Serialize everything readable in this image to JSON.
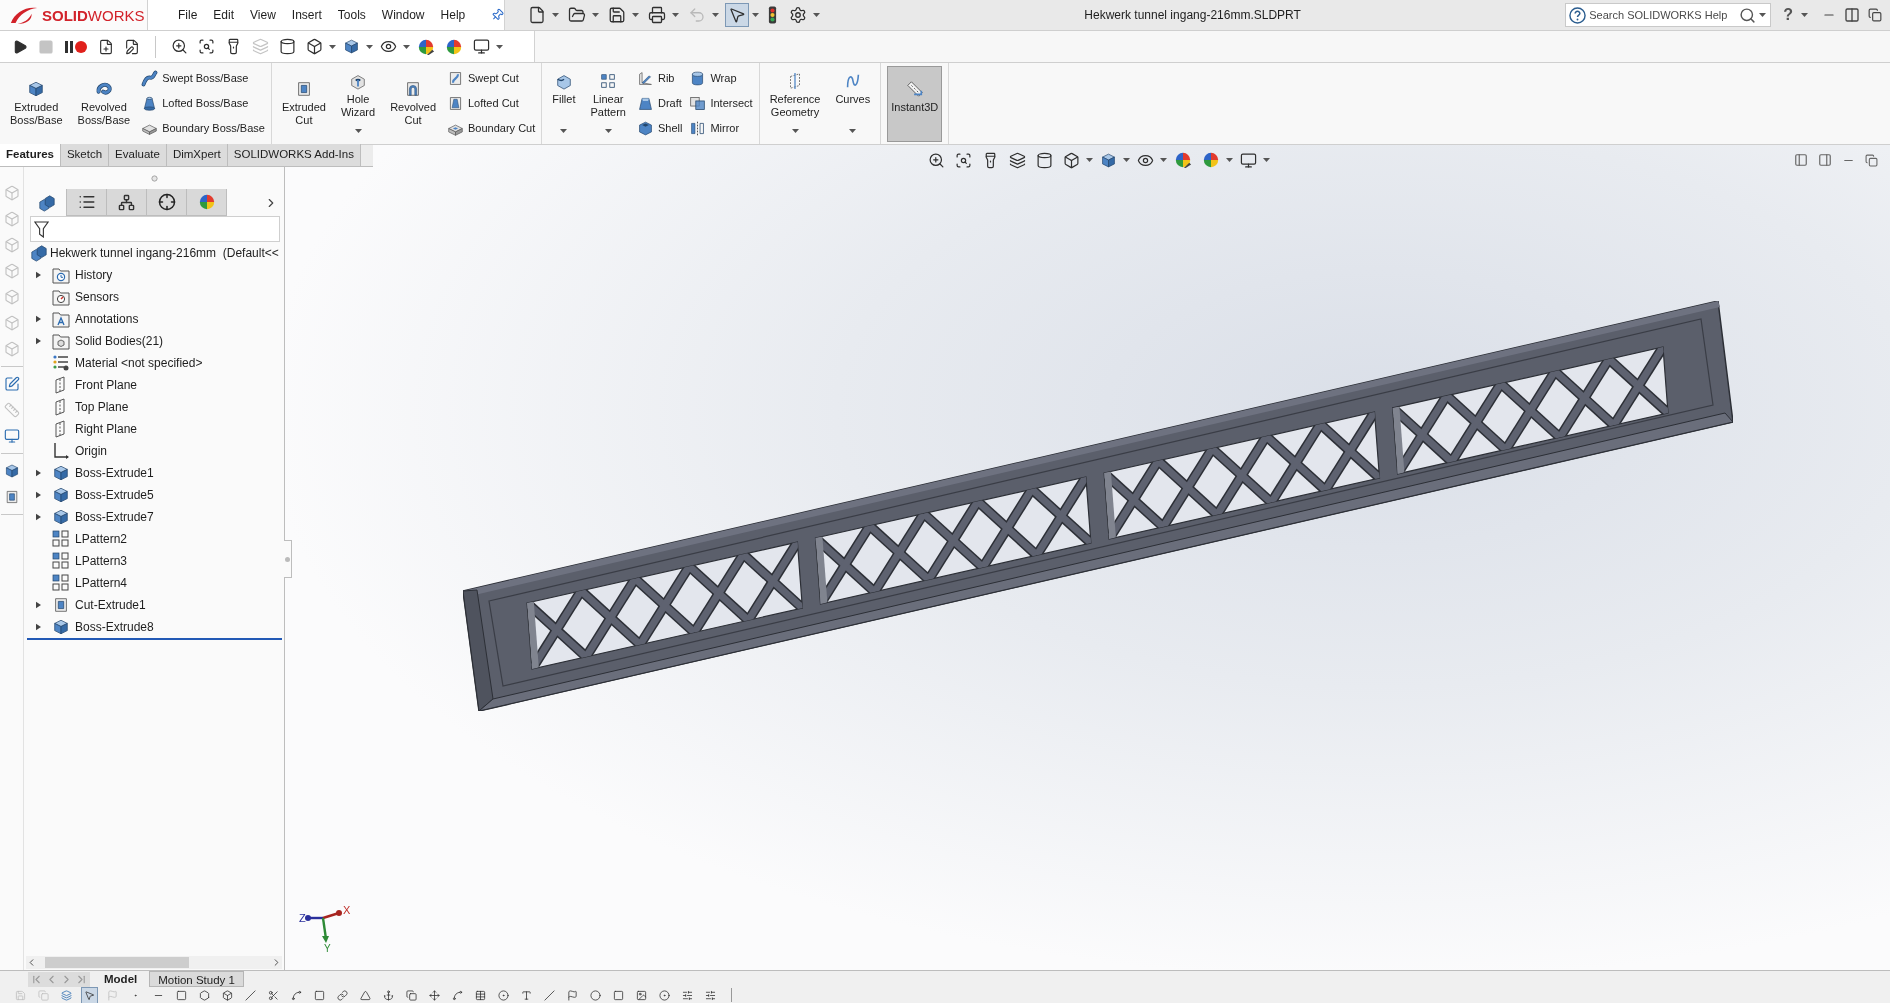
{
  "logo": {
    "text": "**SOLID**WORKS"
  },
  "menu": [
    {
      "label": "File"
    },
    {
      "label": "Edit"
    },
    {
      "label": "View"
    },
    {
      "label": "Insert"
    },
    {
      "label": "Tools"
    },
    {
      "label": "Window"
    },
    {
      "label": "Help"
    }
  ],
  "quick_access": [
    {
      "kind": "new",
      "dropdown": true,
      "disabled": false,
      "active": false
    },
    {
      "kind": "open",
      "dropdown": true,
      "disabled": false,
      "active": false
    },
    {
      "kind": "save",
      "dropdown": true,
      "disabled": false,
      "active": false
    },
    {
      "kind": "print",
      "dropdown": true,
      "disabled": false,
      "active": false
    },
    {
      "kind": "undo",
      "dropdown": true,
      "disabled": true,
      "active": false
    },
    {
      "kind": "select",
      "dropdown": true,
      "disabled": false,
      "active": true
    },
    {
      "kind": "rebuild",
      "dropdown": false,
      "disabled": false,
      "active": false
    },
    {
      "kind": "options",
      "dropdown": true,
      "disabled": false,
      "active": false
    }
  ],
  "window": {
    "title": "Hekwerk tunnel ingang-216mm.SLDPRT"
  },
  "search": {
    "placeholder": "Search SOLIDWORKS Help"
  },
  "help": {
    "label": "?"
  },
  "macro_toolbar": [
    {
      "kind": "play",
      "dropdown": false,
      "disabled": false
    },
    {
      "kind": "stop",
      "dropdown": false,
      "disabled": true
    },
    {
      "kind": "pause-record",
      "dropdown": false,
      "disabled": false
    },
    {
      "kind": "new-macro",
      "dropdown": false,
      "disabled": false
    },
    {
      "kind": "edit-macro",
      "dropdown": false,
      "disabled": false
    }
  ],
  "view_toolbar": [
    {
      "kind": "zoom-fit",
      "dropdown": false,
      "disabled": false
    },
    {
      "kind": "zoom-area",
      "dropdown": false,
      "disabled": false
    },
    {
      "kind": "previous-view",
      "dropdown": false,
      "disabled": false
    },
    {
      "kind": "section-view",
      "dropdown": false,
      "disabled": true
    },
    {
      "kind": "dynamic-view",
      "dropdown": false,
      "disabled": false
    },
    {
      "kind": "view-orientation",
      "dropdown": true,
      "disabled": false
    },
    {
      "kind": "display-style",
      "dropdown": true,
      "disabled": false
    },
    {
      "kind": "hide-show",
      "dropdown": true,
      "disabled": false
    },
    {
      "kind": "edit-appearance",
      "dropdown": false,
      "disabled": false
    },
    {
      "kind": "apply-scene",
      "dropdown": false,
      "disabled": false
    },
    {
      "kind": "view-settings",
      "dropdown": true,
      "disabled": false
    }
  ],
  "command_manager": {
    "groups": [
      {
        "buttons": [
          {
            "kind": "large",
            "label": "Extruded Boss/Base",
            "dropdown": false,
            "active": false
          },
          {
            "kind": "large",
            "label": "Revolved Boss/Base",
            "dropdown": false,
            "active": false
          },
          {
            "kind": "stack",
            "items": [
              {
                "label": "Swept Boss/Base"
              },
              {
                "label": "Lofted Boss/Base"
              },
              {
                "label": "Boundary Boss/Base"
              }
            ]
          }
        ]
      },
      {
        "buttons": [
          {
            "kind": "large",
            "label": "Extruded Cut",
            "dropdown": false,
            "active": false
          },
          {
            "kind": "large",
            "label": "Hole Wizard",
            "dropdown": true,
            "active": false
          },
          {
            "kind": "large",
            "label": "Revolved Cut",
            "dropdown": false,
            "active": false
          },
          {
            "kind": "stack",
            "items": [
              {
                "label": "Swept Cut"
              },
              {
                "label": "Lofted Cut"
              },
              {
                "label": "Boundary Cut"
              }
            ]
          }
        ]
      },
      {
        "buttons": [
          {
            "kind": "large",
            "label": "Fillet",
            "dropdown": true,
            "active": false
          },
          {
            "kind": "large",
            "label": "Linear Pattern",
            "dropdown": true,
            "active": false
          },
          {
            "kind": "stack",
            "items": [
              {
                "label": "Rib"
              },
              {
                "label": "Draft"
              },
              {
                "label": "Shell"
              }
            ]
          },
          {
            "kind": "stack",
            "items": [
              {
                "label": "Wrap"
              },
              {
                "label": "Intersect"
              },
              {
                "label": "Mirror"
              }
            ]
          }
        ]
      },
      {
        "buttons": [
          {
            "kind": "large",
            "label": "Reference Geometry",
            "dropdown": true,
            "active": false
          },
          {
            "kind": "large",
            "label": "Curves",
            "dropdown": true,
            "active": false
          }
        ]
      },
      {
        "buttons": [
          {
            "kind": "large",
            "label": "Instant3D",
            "dropdown": false,
            "active": true
          }
        ]
      }
    ]
  },
  "command_tabs": [
    {
      "label": "Features",
      "selected": true
    },
    {
      "label": "Sketch",
      "selected": false
    },
    {
      "label": "Evaluate",
      "selected": false
    },
    {
      "label": "DimXpert",
      "selected": false
    },
    {
      "label": "SOLIDWORKS Add-Ins",
      "selected": false
    }
  ],
  "side_toolbar": [
    [
      {
        "kind": "view-cube",
        "disabled": true
      },
      {
        "kind": "view-cube",
        "disabled": true
      },
      {
        "kind": "view-cube",
        "disabled": true
      },
      {
        "kind": "view-cube",
        "disabled": true
      },
      {
        "kind": "view-cube",
        "disabled": true
      },
      {
        "kind": "view-cube",
        "disabled": true
      },
      {
        "kind": "view-cube",
        "disabled": true
      }
    ],
    [
      {
        "kind": "sketch",
        "disabled": false
      },
      {
        "kind": "smart-dimension",
        "disabled": true
      },
      {
        "kind": "display-sketch",
        "disabled": false
      }
    ],
    [
      {
        "kind": "extrude",
        "disabled": false
      },
      {
        "kind": "cut",
        "disabled": false
      }
    ]
  ],
  "feature_manager": {
    "tabs": [
      {
        "kind": "features",
        "selected": true
      },
      {
        "kind": "properties",
        "selected": false
      },
      {
        "kind": "configurations",
        "selected": false
      },
      {
        "kind": "dimxpert",
        "selected": false
      },
      {
        "kind": "display",
        "selected": false
      }
    ],
    "root": {
      "label": "Hekwerk tunnel ingang-216mm  (Default<<"
    },
    "items": [
      {
        "label": "History",
        "kind": "history",
        "expandable": true,
        "expanded": false
      },
      {
        "label": "Sensors",
        "kind": "sensors",
        "expandable": false
      },
      {
        "label": "Annotations",
        "kind": "annotations",
        "expandable": true,
        "expanded": false
      },
      {
        "label": "Solid Bodies(21)",
        "kind": "bodies",
        "expandable": true,
        "expanded": false
      },
      {
        "label": "Material <not specified>",
        "kind": "material",
        "expandable": false
      },
      {
        "label": "Front Plane",
        "kind": "plane",
        "expandable": false
      },
      {
        "label": "Top Plane",
        "kind": "plane",
        "expandable": false
      },
      {
        "label": "Right Plane",
        "kind": "plane",
        "expandable": false
      },
      {
        "label": "Origin",
        "kind": "origin",
        "expandable": false
      },
      {
        "label": "Boss-Extrude1",
        "kind": "extrude",
        "expandable": true,
        "expanded": false
      },
      {
        "label": "Boss-Extrude5",
        "kind": "extrude",
        "expandable": true,
        "expanded": false
      },
      {
        "label": "Boss-Extrude7",
        "kind": "extrude",
        "expandable": true,
        "expanded": false
      },
      {
        "label": "LPattern2",
        "kind": "pattern",
        "expandable": false
      },
      {
        "label": "LPattern3",
        "kind": "pattern",
        "expandable": false
      },
      {
        "label": "LPattern4",
        "kind": "pattern",
        "expandable": false
      },
      {
        "label": "Cut-Extrude1",
        "kind": "cut",
        "expandable": true,
        "expanded": false
      },
      {
        "label": "Boss-Extrude8",
        "kind": "extrude",
        "expandable": true,
        "expanded": false
      }
    ]
  },
  "heads_up_toolbar": [
    {
      "kind": "zoom-fit",
      "dropdown": false
    },
    {
      "kind": "zoom-area",
      "dropdown": false
    },
    {
      "kind": "previous-view",
      "dropdown": false
    },
    {
      "kind": "section-view",
      "dropdown": false
    },
    {
      "kind": "dynamic-view",
      "dropdown": false
    },
    {
      "kind": "view-orientation",
      "dropdown": true
    },
    {
      "kind": "display-style",
      "dropdown": true
    },
    {
      "kind": "hide-show",
      "dropdown": true
    },
    {
      "kind": "edit-appearance",
      "dropdown": false
    },
    {
      "kind": "apply-scene",
      "dropdown": true
    },
    {
      "kind": "view-settings",
      "dropdown": true
    }
  ],
  "triad": {
    "x": "X",
    "y": "Y",
    "z": "Z"
  },
  "bottom_tabs": [
    {
      "label": "Model",
      "selected": true
    },
    {
      "label": "Motion Study 1",
      "selected": false
    }
  ],
  "sketch_toolbar": [
    {
      "kind": "save",
      "disabled": true,
      "active": false
    },
    {
      "kind": "copy",
      "disabled": true,
      "active": false
    },
    {
      "kind": "layers",
      "disabled": false,
      "active": false
    },
    {
      "kind": "select",
      "disabled": false,
      "active": true
    },
    {
      "kind": "flag",
      "disabled": true,
      "active": false
    },
    {
      "kind": "dot",
      "disabled": false,
      "active": false
    },
    {
      "kind": "line",
      "disabled": false,
      "active": false
    },
    {
      "kind": "square",
      "disabled": false,
      "active": false
    },
    {
      "kind": "hexagon",
      "disabled": false,
      "active": false
    },
    {
      "kind": "box",
      "disabled": false,
      "active": false
    },
    {
      "kind": "slash",
      "disabled": false,
      "active": false
    },
    {
      "kind": "scissors",
      "disabled": false,
      "active": false
    },
    {
      "kind": "spline",
      "disabled": false,
      "active": false
    },
    {
      "kind": "square",
      "disabled": false,
      "active": false
    },
    {
      "kind": "link",
      "disabled": false,
      "active": false
    },
    {
      "kind": "triangle",
      "disabled": false,
      "active": false
    },
    {
      "kind": "anchor",
      "disabled": false,
      "active": false
    },
    {
      "kind": "copy",
      "disabled": false,
      "active": false
    },
    {
      "kind": "move",
      "disabled": false,
      "active": false
    },
    {
      "kind": "spline",
      "disabled": false,
      "active": false
    },
    {
      "kind": "table",
      "disabled": false,
      "active": false
    },
    {
      "kind": "circle-dot",
      "disabled": false,
      "active": false
    },
    {
      "kind": "type",
      "disabled": false,
      "active": false
    },
    {
      "kind": "slash",
      "disabled": false,
      "active": false
    },
    {
      "kind": "flag",
      "disabled": false,
      "active": false
    },
    {
      "kind": "circle",
      "disabled": false,
      "active": false
    },
    {
      "kind": "square",
      "disabled": false,
      "active": false
    },
    {
      "kind": "image",
      "disabled": false,
      "active": false
    },
    {
      "kind": "circle-dot",
      "disabled": false,
      "active": false
    },
    {
      "kind": "sliders",
      "disabled": false,
      "active": false
    },
    {
      "kind": "sliders",
      "disabled": false,
      "active": false
    }
  ]
}
